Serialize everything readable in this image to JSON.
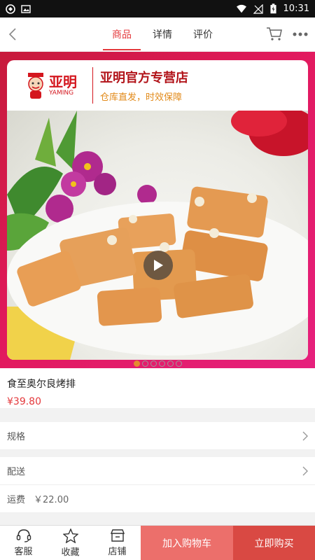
{
  "status_bar": {
    "time": "10:31"
  },
  "nav": {
    "tabs": [
      {
        "label": "商品"
      },
      {
        "label": "详情"
      },
      {
        "label": "评价"
      }
    ]
  },
  "banner": {
    "logo_cn": "亚明",
    "logo_en": "YAMING",
    "store_name": "亚明官方专营店",
    "store_slogan": "仓库直发，时效保障"
  },
  "product": {
    "name": "食至奥尔良烤排",
    "price": "¥39.80"
  },
  "rows": {
    "spec_label": "规格",
    "delivery_label": "配送",
    "shipping_label": "运费",
    "shipping_value": "￥22.00"
  },
  "bottom": {
    "service_label": "客服",
    "favorite_label": "收藏",
    "shop_label": "店铺",
    "add_cart_label": "加入购物车",
    "buy_now_label": "立即购买"
  },
  "colors": {
    "accent": "#e4393c",
    "cart_button": "#ec6f6b",
    "buy_button": "#d94943"
  },
  "icons": [
    "back-icon",
    "cart-icon",
    "more-icon",
    "play-icon",
    "headset-icon",
    "star-icon",
    "shop-icon",
    "chevron-right-icon"
  ]
}
